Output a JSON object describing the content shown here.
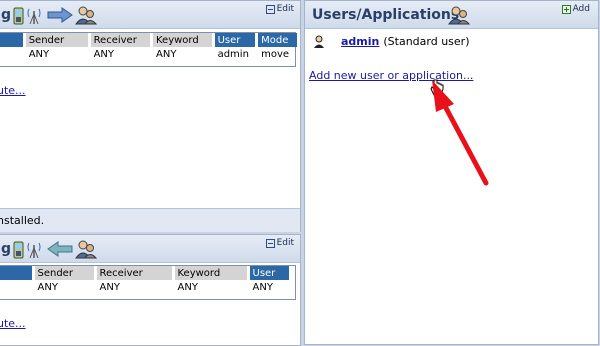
{
  "rule_panel_1": {
    "title_fragment": "g",
    "edit_label": "Edit",
    "columns": [
      "Sender",
      "Receiver",
      "Keyword",
      "User",
      "Mode"
    ],
    "row": [
      "ANY",
      "ANY",
      "ANY",
      "admin",
      "move"
    ],
    "link_fragment": "ute...",
    "status_fragment": "nstalled."
  },
  "rule_panel_2": {
    "title_fragment": "g",
    "edit_label": "Edit",
    "columns": [
      "Sender",
      "Receiver",
      "Keyword",
      "User"
    ],
    "row": [
      "ANY",
      "ANY",
      "ANY",
      "ANY"
    ],
    "link_fragment": "ute..."
  },
  "users_panel": {
    "title": "Users/Applications",
    "add_label": "Add",
    "users": [
      {
        "name": "admin",
        "role": "(Standard user)"
      }
    ],
    "add_link": "Add new user or application..."
  },
  "colors": {
    "selected_header": "#2c68a8",
    "arrow_annotation": "#e8101a",
    "link": "#1a1aa6"
  }
}
